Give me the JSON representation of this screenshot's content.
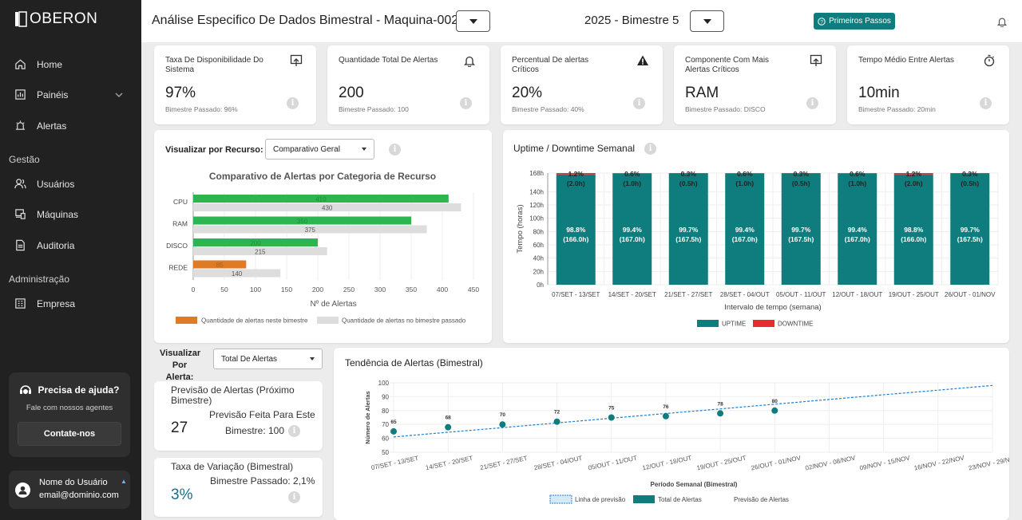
{
  "app": {
    "name": "OBERON"
  },
  "sidebar": {
    "items": [
      {
        "label": "Home",
        "icon": "home-icon"
      },
      {
        "label": "Painéis",
        "icon": "bar-chart-icon"
      },
      {
        "label": "Alertas",
        "icon": "alarm-icon"
      }
    ],
    "section_gestao": "Gestão",
    "gestao_items": [
      {
        "label": "Usuários",
        "icon": "users-icon"
      },
      {
        "label": "Máquinas",
        "icon": "devices-icon"
      },
      {
        "label": "Auditoria",
        "icon": "document-icon"
      }
    ],
    "section_admin": "Administração",
    "admin_items": [
      {
        "label": "Empresa",
        "icon": "building-icon"
      }
    ],
    "help": {
      "title": "Precisa de ajuda?",
      "subtitle": "Fale com nossos agentes",
      "button": "Contate-nos"
    },
    "user": {
      "name": "Nome do Usuário",
      "email": "email@dominio.com"
    }
  },
  "header": {
    "title": "Análise Especifico De Dados Bimestral - Maquina-002",
    "period": "2025 - Bimestre 5",
    "first_steps": "Primeiros Passos"
  },
  "kpis": [
    {
      "label": "Taxa De Disponibilidade Do Sistema",
      "value": "97%",
      "previous": "Bimestre Passado: 96%",
      "icon": "trend-up-icon"
    },
    {
      "label": "Quantidade Total De Alertas",
      "value": "200",
      "previous": "Bimestre Passado: 100",
      "icon": "bell-icon"
    },
    {
      "label": "Percentual De alertas Críticos",
      "value": "20%",
      "previous": "Bimestre Passado: 40%",
      "icon": "warning-icon"
    },
    {
      "label": "Componente Com Mais Alertas Críticos",
      "value": "RAM",
      "previous": "Bimestre Passado: DISCO",
      "icon": "trend-up-icon"
    },
    {
      "label": "Tempo Médio Entre Alertas",
      "value": "10min",
      "previous": "Bimestre Passado: 20min",
      "icon": "stopwatch-icon"
    }
  ],
  "resource_panel": {
    "view_label": "Visualizar por Recurso:",
    "view_selected": "Comparativo Geral"
  },
  "alert_panel": {
    "view_label_line1": "Visualizar",
    "view_label_line2": "Por Alerta:",
    "view_selected": "Total De Alertas"
  },
  "prediction_card": {
    "title": "Previsão de Alertas (Próximo Bimestre)",
    "value": "27",
    "sub_line1": "Previsão Feita Para Este",
    "sub_line2": "Bimestre: 100"
  },
  "variation_card": {
    "title": "Taxa de Variação (Bimestral)",
    "sub": "Bimestre Passado: 2,1%",
    "value": "3%"
  },
  "colors": {
    "teal": "#0f7d7d",
    "orange": "#e07b24",
    "green": "#2db552",
    "gray": "#dddddd",
    "red": "#e62c2c",
    "sidebar": "#212121"
  },
  "chart_data": [
    {
      "type": "bar",
      "orientation": "horizontal",
      "title": "Comparativo de Alertas por Categoria de Recurso",
      "categories": [
        "CPU",
        "RAM",
        "DISCO",
        "REDE"
      ],
      "series": [
        {
          "name": "Quantidade de alertas neste bimestre",
          "values": [
            410,
            350,
            200,
            85
          ],
          "colors": [
            "#2db552",
            "#2db552",
            "#2db552",
            "#e07b24"
          ]
        },
        {
          "name": "Quantidade de alertas no bimestre passado",
          "values": [
            430,
            375,
            215,
            140
          ],
          "color": "#dddddd"
        }
      ],
      "xlabel": "Nº de Alertas",
      "xlim": [
        0,
        450
      ],
      "xticks": [
        0,
        50,
        100,
        150,
        200,
        250,
        300,
        350,
        400,
        450
      ],
      "legend": "bottom"
    },
    {
      "type": "bar",
      "stacked": true,
      "title": "Uptime / Downtime Semanal",
      "categories": [
        "07/SET - 13/SET",
        "14/SET - 20/SET",
        "21/SET - 27/SET",
        "28/SET - 04/OUT",
        "05/OUT - 11/OUT",
        "12/OUT - 18/OUT",
        "19/OUT - 25/OUT",
        "26/OUT - 01/NOV"
      ],
      "series": [
        {
          "name": "UPTIME",
          "values": [
            166.0,
            167.0,
            167.5,
            167.0,
            167.5,
            167.0,
            166.0,
            167.5
          ],
          "labels": [
            "98.8%",
            "99.4%",
            "99.7%",
            "99.4%",
            "99.7%",
            "99.4%",
            "98.8%",
            "99.7%"
          ],
          "value_labels": [
            "(166.0h)",
            "(167.0h)",
            "(167.5h)",
            "(167.0h)",
            "(167.5h)",
            "(167.0h)",
            "(166.0h)",
            "(167.5h)"
          ],
          "color": "#0f7d7d"
        },
        {
          "name": "DOWNTIME",
          "values": [
            2.0,
            1.0,
            0.5,
            1.0,
            0.5,
            1.0,
            2.0,
            0.5
          ],
          "labels": [
            "1.2%",
            "0.6%",
            "0.3%",
            "0.6%",
            "0.3%",
            "0.6%",
            "1.2%",
            "0.3%"
          ],
          "value_labels": [
            "(2.0h)",
            "(1.0h)",
            "(0.5h)",
            "(1.0h)",
            "(0.5h)",
            "(1.0h)",
            "(2.0h)",
            "(0.5h)"
          ],
          "color": "#e62c2c"
        }
      ],
      "ylabel": "Tempo  (horas)",
      "xlabel": "Intervalo de tempo (semana)",
      "ylim": [
        0,
        168
      ],
      "yticks": [
        "0h",
        "20h",
        "40h",
        "60h",
        "80h",
        "100h",
        "120h",
        "140h",
        "168h"
      ],
      "ytick_values": [
        0,
        20,
        40,
        60,
        80,
        100,
        120,
        140,
        168
      ],
      "legend": "bottom"
    },
    {
      "type": "scatter",
      "title": "Tendência de Alertas (Bimestral)",
      "categories": [
        "07/SET - 13/SET",
        "14/SET - 20/SET",
        "21/SET - 27/SET",
        "28/SET - 04/OUT",
        "05/OUT - 11/OUT",
        "12/OUT - 18/OUT",
        "19/OUT - 25/OUT",
        "26/OUT - 01/NOV",
        "02/NOV - 08/NOV",
        "09/NOV - 15/NOV",
        "16/NOV - 22/NOV",
        "23/NOV - 29/NOV"
      ],
      "series": [
        {
          "name": "Total de Alertas",
          "values": [
            65,
            68,
            70,
            72,
            75,
            76,
            78,
            80
          ],
          "labels": [
            "65",
            "68",
            "70",
            "72",
            "75",
            "76",
            "78",
            "80"
          ],
          "color": "#0f7d7d"
        },
        {
          "name": "Linha de previsão",
          "type": "line",
          "dashed": true,
          "values": [
            61,
            64.4,
            67.7,
            71.1,
            74.5,
            77.9,
            81.2,
            84.6,
            88,
            91.4,
            94.7,
            98.1
          ],
          "color": "#1a7fd4"
        },
        {
          "name": "Previsão de Alertas",
          "values": []
        }
      ],
      "ylabel": "Número de Alertas",
      "xlabel": "Período Semanal (Bimestral)",
      "ylim": [
        50,
        100
      ],
      "yticks": [
        50,
        60,
        70,
        80,
        90,
        100
      ],
      "legend": "bottom"
    }
  ]
}
